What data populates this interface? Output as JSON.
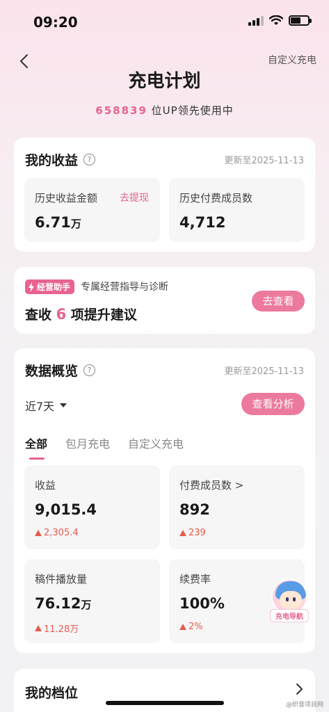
{
  "status_bar": {
    "time": "09:20"
  },
  "nav": {
    "right_label": "自定义充电"
  },
  "header": {
    "title": "充电计划",
    "subtitle_number": "658839",
    "subtitle_text": " 位UP领先使用中"
  },
  "earnings": {
    "title": "我的收益",
    "update": "更新至2025-11-13",
    "total_label": "历史收益金额",
    "withdraw_label": "去提现",
    "total_value": "6.71",
    "total_unit": "万",
    "members_label": "历史付费成员数",
    "members_value": "4,712"
  },
  "assistant_card": {
    "badge": "经营助手",
    "desc": "专属经营指导与诊断",
    "advice_prefix": "查收",
    "advice_count": "6",
    "advice_suffix": "项提升建议",
    "button": "去查看"
  },
  "overview": {
    "title": "数据概览",
    "update": "更新至2025-11-13",
    "period": "近7天",
    "analyze_button": "查看分析",
    "tabs": [
      "全部",
      "包月充电",
      "自定义充电"
    ],
    "stats": [
      {
        "label": "收益",
        "value": "9,015.4",
        "unit": "",
        "delta": "2,305.4"
      },
      {
        "label": "付费成员数 >",
        "value": "892",
        "unit": "",
        "delta": "239"
      },
      {
        "label": "稿件播放量",
        "value": "76.12",
        "unit": "万",
        "delta": "11.28万"
      },
      {
        "label": "续费率",
        "value": "100%",
        "unit": "",
        "delta": "2%"
      }
    ]
  },
  "floating_assistant": {
    "label": "充电导航"
  },
  "tier": {
    "title": "我的档位"
  },
  "watermark": "@织音项目网",
  "colors": {
    "accent": "#e7628d",
    "increase": "#e45c4d",
    "button": "#ec7a9c"
  }
}
